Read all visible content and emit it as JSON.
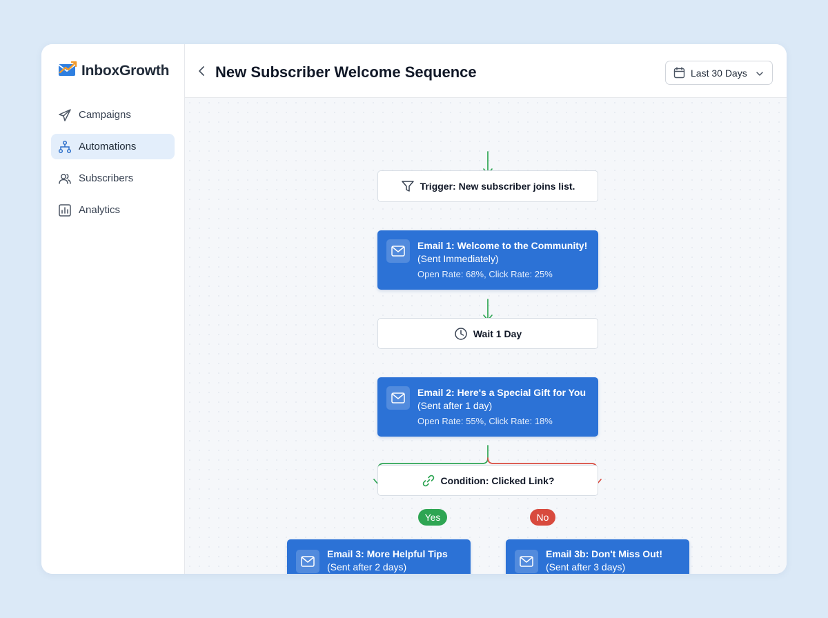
{
  "app": {
    "name": "InboxGrowth"
  },
  "sidebar": {
    "items": [
      {
        "label": "Campaigns",
        "icon": "paper-plane-icon",
        "active": false
      },
      {
        "label": "Automations",
        "icon": "workflow-icon",
        "active": true
      },
      {
        "label": "Subscribers",
        "icon": "users-icon",
        "active": false
      },
      {
        "label": "Analytics",
        "icon": "bar-chart-icon",
        "active": false
      }
    ]
  },
  "header": {
    "title": "New Subscriber Welcome Sequence",
    "date_range": "Last 30 Days"
  },
  "flow": {
    "trigger": {
      "label": "Trigger: New subscriber joins list.",
      "icon": "filter-icon"
    },
    "email1": {
      "title": "Email 1: Welcome to the Community!",
      "subtitle": "(Sent Immediately)",
      "stats": "Open Rate: 68%, Click Rate: 25%"
    },
    "wait": {
      "label": "Wait 1 Day",
      "icon": "clock-icon"
    },
    "email2": {
      "title": "Email 2: Here's a Special Gift for You",
      "subtitle": "(Sent after 1 day)",
      "stats": "Open Rate: 55%, Click Rate: 18%"
    },
    "condition": {
      "label": "Condition: Clicked Link?",
      "icon": "link-icon"
    },
    "branch_yes": "Yes",
    "branch_no": "No",
    "email3": {
      "title": "Email 3: More Helpful Tips",
      "subtitle": "(Sent after 2 days)"
    },
    "email3b": {
      "title": "Email 3b: Don't Miss Out!",
      "subtitle": "(Sent after 3 days)"
    }
  },
  "colors": {
    "accent_blue": "#2c72d6",
    "connector_green": "#2ea553",
    "connector_red": "#d84a3e",
    "page_background": "#dbe9f7"
  }
}
